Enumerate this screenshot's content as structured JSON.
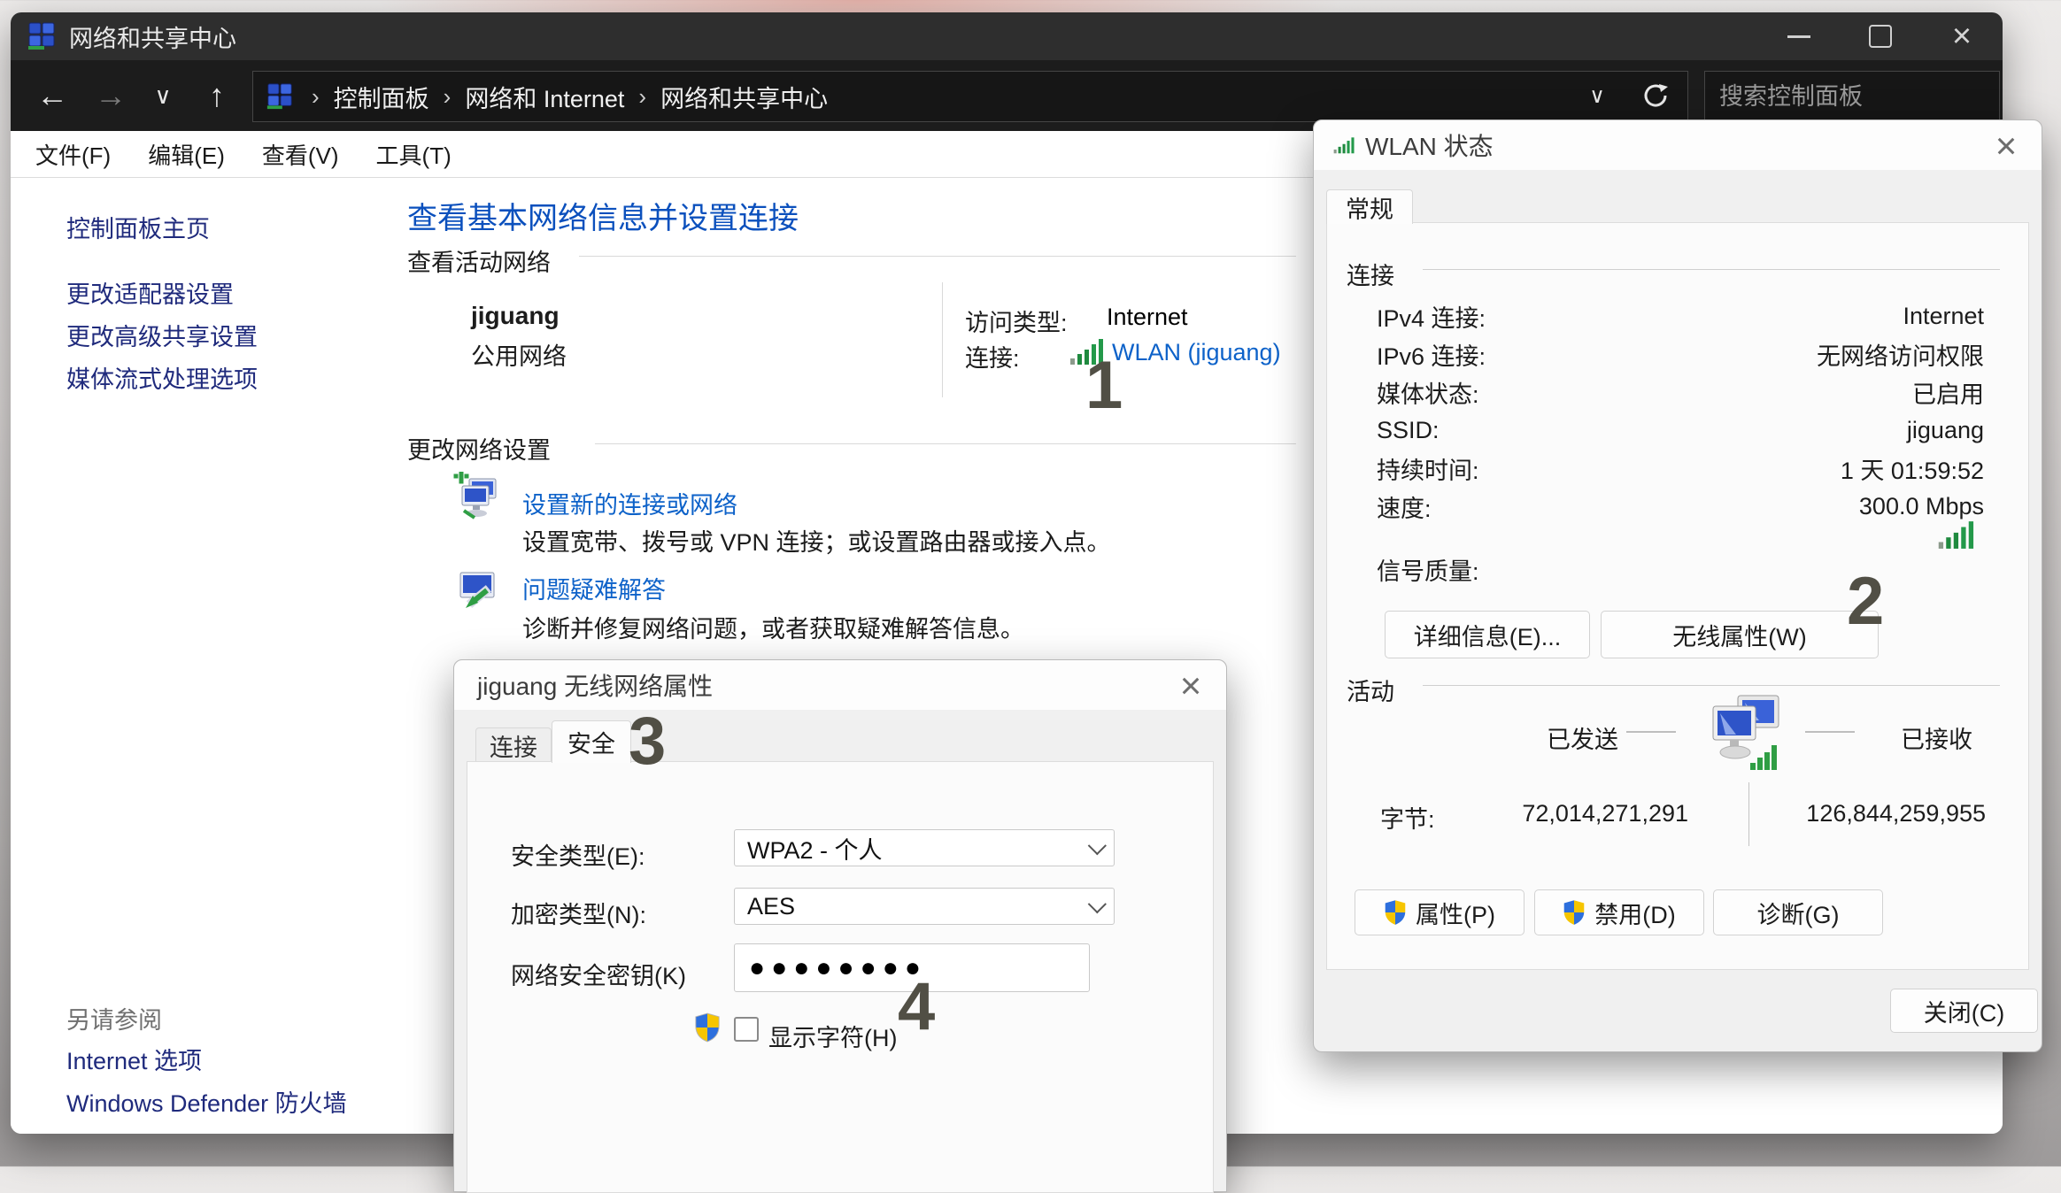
{
  "main_window": {
    "title": "网络和共享中心",
    "menu": [
      "文件(F)",
      "编辑(E)",
      "查看(V)",
      "工具(T)"
    ],
    "breadcrumb_separator": "›",
    "breadcrumb": [
      "控制面板",
      "网络和 Internet",
      "网络和共享中心"
    ],
    "search_placeholder": "搜索控制面板",
    "sidebar": {
      "items": [
        "控制面板主页",
        "更改适配器设置",
        "更改高级共享设置",
        "媒体流式处理选项"
      ],
      "see_also_header": "另请参阅",
      "see_also_items": [
        "Internet 选项",
        "Windows Defender 防火墙"
      ]
    },
    "content": {
      "title": "查看基本网络信息并设置连接",
      "active_networks_section": "查看活动网络",
      "network_name": "jiguang",
      "network_type": "公用网络",
      "access_label": "访问类型:",
      "access_value": "Internet",
      "connection_label": "连接:",
      "connection_value": "WLAN (jiguang)",
      "change_settings_section": "更改网络设置",
      "tasks": [
        {
          "title": "设置新的连接或网络",
          "desc": "设置宽带、拨号或 VPN 连接；或设置路由器或接入点。"
        },
        {
          "title": "问题疑难解答",
          "desc": "诊断并修复网络问题，或者获取疑难解答信息。"
        }
      ]
    }
  },
  "wlan_dialog": {
    "title": "WLAN 状态",
    "tab_general": "常规",
    "connection_section": "连接",
    "rows": [
      {
        "label": "IPv4 连接:",
        "value": "Internet"
      },
      {
        "label": "IPv6 连接:",
        "value": "无网络访问权限"
      },
      {
        "label": "媒体状态:",
        "value": "已启用"
      },
      {
        "label": "SSID:",
        "value": "jiguang"
      },
      {
        "label": "持续时间:",
        "value": "1 天 01:59:52"
      },
      {
        "label": "速度:",
        "value": "300.0 Mbps"
      }
    ],
    "signal_label": "信号质量:",
    "details_button": "详细信息(E)...",
    "wireless_props_button": "无线属性(W)",
    "activity_section": "活动",
    "sent_label": "已发送",
    "received_label": "已接收",
    "bytes_label": "字节:",
    "bytes_sent": "72,014,271,291",
    "bytes_received": "126,844,259,955",
    "properties_button": "属性(P)",
    "disable_button": "禁用(D)",
    "diagnose_button": "诊断(G)",
    "close_button": "关闭(C)"
  },
  "props_dialog": {
    "title": "jiguang 无线网络属性",
    "tab_connection": "连接",
    "tab_security": "安全",
    "security_type_label": "安全类型(E):",
    "security_type_value": "WPA2 - 个人",
    "encryption_label": "加密类型(N):",
    "encryption_value": "AES",
    "key_label": "网络安全密钥(K)",
    "key_value": "●●●●●●●●",
    "show_chars_label": "显示字符(H)"
  },
  "annotations": [
    "1",
    "2",
    "3",
    "4"
  ],
  "colors": {
    "link_blue": "#0d62c9",
    "heading_blue": "#0b50bd",
    "sidebar_navy": "#1f2a7c",
    "signal_green": "#1f8a3f",
    "annotation_gray": "#514f45",
    "titlebar_dark": "#2e2e2e"
  }
}
